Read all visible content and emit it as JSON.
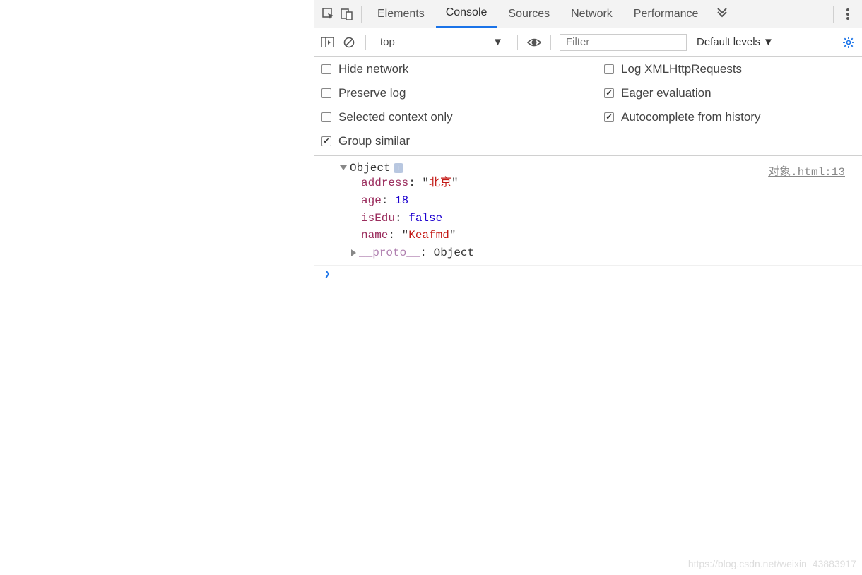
{
  "tabs": {
    "elements": "Elements",
    "console": "Console",
    "sources": "Sources",
    "network": "Network",
    "performance": "Performance"
  },
  "toolbar": {
    "context": "top",
    "filter_placeholder": "Filter",
    "levels_label": "Default levels"
  },
  "settings": {
    "hide_network": "Hide network",
    "log_xhr": "Log XMLHttpRequests",
    "preserve_log": "Preserve log",
    "eager_eval": "Eager evaluation",
    "selected_ctx": "Selected context only",
    "autocomplete": "Autocomplete from history",
    "group_similar": "Group similar"
  },
  "log": {
    "object_label": "Object",
    "source_link": "对象.html:13",
    "props": {
      "address_key": "address",
      "address_val": "北京",
      "age_key": "age",
      "age_val": "18",
      "isEdu_key": "isEdu",
      "isEdu_val": "false",
      "name_key": "name",
      "name_val": "Keafmd",
      "proto_key": "__proto__",
      "proto_val": "Object"
    }
  },
  "watermark": "https://blog.csdn.net/weixin_43883917"
}
